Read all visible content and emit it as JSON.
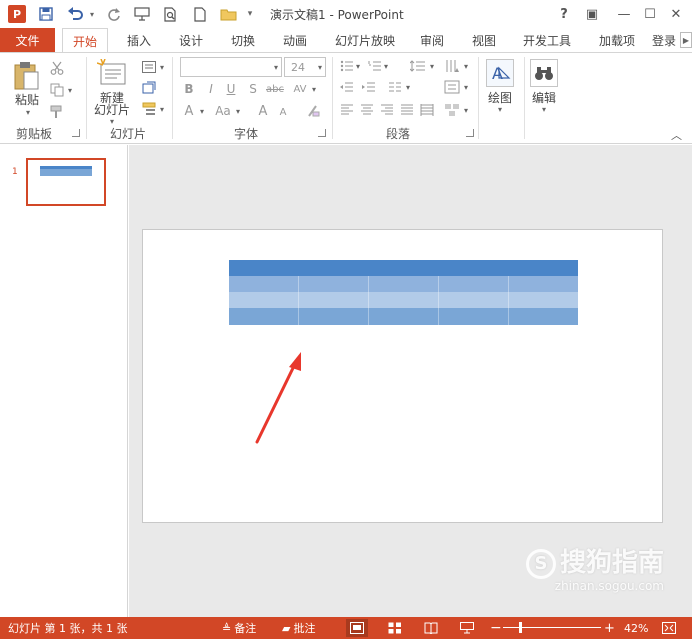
{
  "title_bar": {
    "app_badge": "P",
    "window_title": "演示文稿1 - PowerPoint",
    "help": "?",
    "restore_ribbon": "▣",
    "minimize": "—",
    "maximize": "☐",
    "close": "✕"
  },
  "tabs": {
    "file": "文件",
    "items": [
      "开始",
      "插入",
      "设计",
      "切换",
      "动画",
      "幻灯片放映",
      "审阅",
      "视图",
      "开发工具",
      "加载项",
      "登录"
    ],
    "active": "开始"
  },
  "ribbon": {
    "clipboard": {
      "paste_label": "粘贴",
      "group_label": "剪贴板"
    },
    "slides": {
      "new_slide_line1": "新建",
      "new_slide_line2": "幻灯片",
      "group_label": "幻灯片"
    },
    "font": {
      "font_name": "",
      "font_size": "24",
      "group_label": "字体",
      "bold": "B",
      "italic": "I",
      "underline": "U",
      "strike": "S",
      "shadow": "abc",
      "spacing": "AV",
      "color_a": "A",
      "case": "Aa",
      "grow": "A",
      "shrink": "A"
    },
    "paragraph": {
      "group_label": "段落"
    },
    "drawing": {
      "label": "绘图"
    },
    "editing": {
      "label": "编辑"
    }
  },
  "thumbnails": {
    "slide_number": "1"
  },
  "table": {
    "colors": {
      "header": "#4a85c8",
      "row_a": "#8fb2dd",
      "row_b": "#b2cbe8",
      "row_c": "#7aa6d6"
    },
    "columns": 5,
    "rows": 4
  },
  "watermark": {
    "main": "搜狗指南",
    "sub": "zhinan.sogou.com"
  },
  "status_bar": {
    "slide_info": "幻灯片 第 1 张，共 1 张",
    "notes": "备注",
    "comments": "批注",
    "zoom": "42%"
  },
  "colors": {
    "accent": "#d24726",
    "arrow": "#e8372c"
  }
}
